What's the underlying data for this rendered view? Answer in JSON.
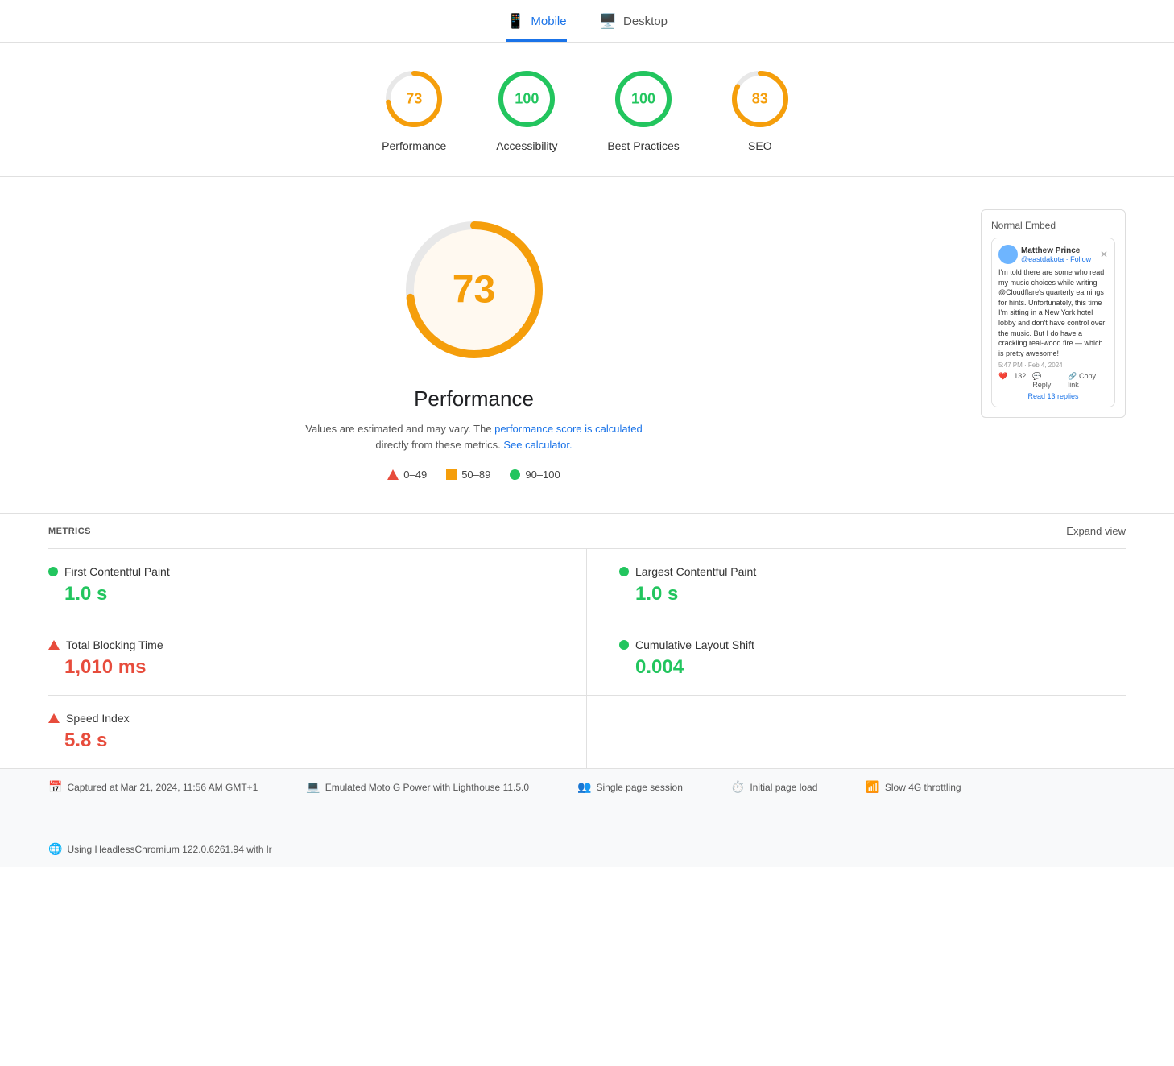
{
  "tabs": [
    {
      "id": "mobile",
      "label": "Mobile",
      "icon": "📱",
      "active": true
    },
    {
      "id": "desktop",
      "label": "Desktop",
      "icon": "🖥️",
      "active": false
    }
  ],
  "scoreCards": [
    {
      "id": "performance",
      "label": "Performance",
      "score": 73,
      "color": "orange",
      "strokeColor": "#f59e0b",
      "percentage": 73
    },
    {
      "id": "accessibility",
      "label": "Accessibility",
      "score": 100,
      "color": "green",
      "strokeColor": "#22c55e",
      "percentage": 100
    },
    {
      "id": "best-practices",
      "label": "Best Practices",
      "score": 100,
      "color": "green",
      "strokeColor": "#22c55e",
      "percentage": 100
    },
    {
      "id": "seo",
      "label": "SEO",
      "score": 83,
      "color": "orange",
      "strokeColor": "#f59e0b",
      "percentage": 83
    }
  ],
  "mainScore": {
    "value": 73,
    "title": "Performance",
    "description": "Values are estimated and may vary. The",
    "linkText": "performance score is calculated",
    "descriptionContinued": "directly from these metrics.",
    "calculatorLink": "See calculator.",
    "color": "#f59e0b"
  },
  "legend": [
    {
      "type": "triangle",
      "range": "0–49",
      "color": "#e74c3c"
    },
    {
      "type": "square",
      "range": "50–89",
      "color": "#f59e0b"
    },
    {
      "type": "circle",
      "range": "90–100",
      "color": "#22c55e"
    }
  ],
  "embedCard": {
    "title": "Normal Embed",
    "tweetUser": "Matthew Prince",
    "tweetHandle": "@eastdakota · Follow",
    "tweetBody": "I'm told there are some who read my music choices while writing @Cloudflare's quarterly earnings for hints. Unfortunately, this time I'm sitting in a New York hotel lobby and don't have control over the music. But I do have a crackling real-wood fire — which is pretty awesome!",
    "tweetTime": "5:47 PM · Feb 4, 2024",
    "tweetLikes": "132",
    "tweetReplies": "Read 13 replies"
  },
  "metrics": {
    "label": "METRICS",
    "expandLabel": "Expand view",
    "items": [
      {
        "id": "fcp",
        "name": "First Contentful Paint",
        "value": "1.0 s",
        "indicator": "circle",
        "color": "green"
      },
      {
        "id": "lcp",
        "name": "Largest Contentful Paint",
        "value": "1.0 s",
        "indicator": "circle",
        "color": "green"
      },
      {
        "id": "tbt",
        "name": "Total Blocking Time",
        "value": "1,010 ms",
        "indicator": "triangle",
        "color": "red"
      },
      {
        "id": "cls",
        "name": "Cumulative Layout Shift",
        "value": "0.004",
        "indicator": "circle",
        "color": "green"
      },
      {
        "id": "si",
        "name": "Speed Index",
        "value": "5.8 s",
        "indicator": "triangle",
        "color": "red"
      }
    ]
  },
  "footer": {
    "items": [
      {
        "icon": "📅",
        "text": "Captured at Mar 21, 2024, 11:56 AM GMT+1"
      },
      {
        "icon": "💻",
        "text": "Emulated Moto G Power with Lighthouse 11.5.0"
      },
      {
        "icon": "👥",
        "text": "Single page session"
      },
      {
        "icon": "⏱️",
        "text": "Initial page load"
      },
      {
        "icon": "📶",
        "text": "Slow 4G throttling"
      },
      {
        "icon": "🌐",
        "text": "Using HeadlessChromium 122.0.6261.94 with lr"
      }
    ]
  }
}
